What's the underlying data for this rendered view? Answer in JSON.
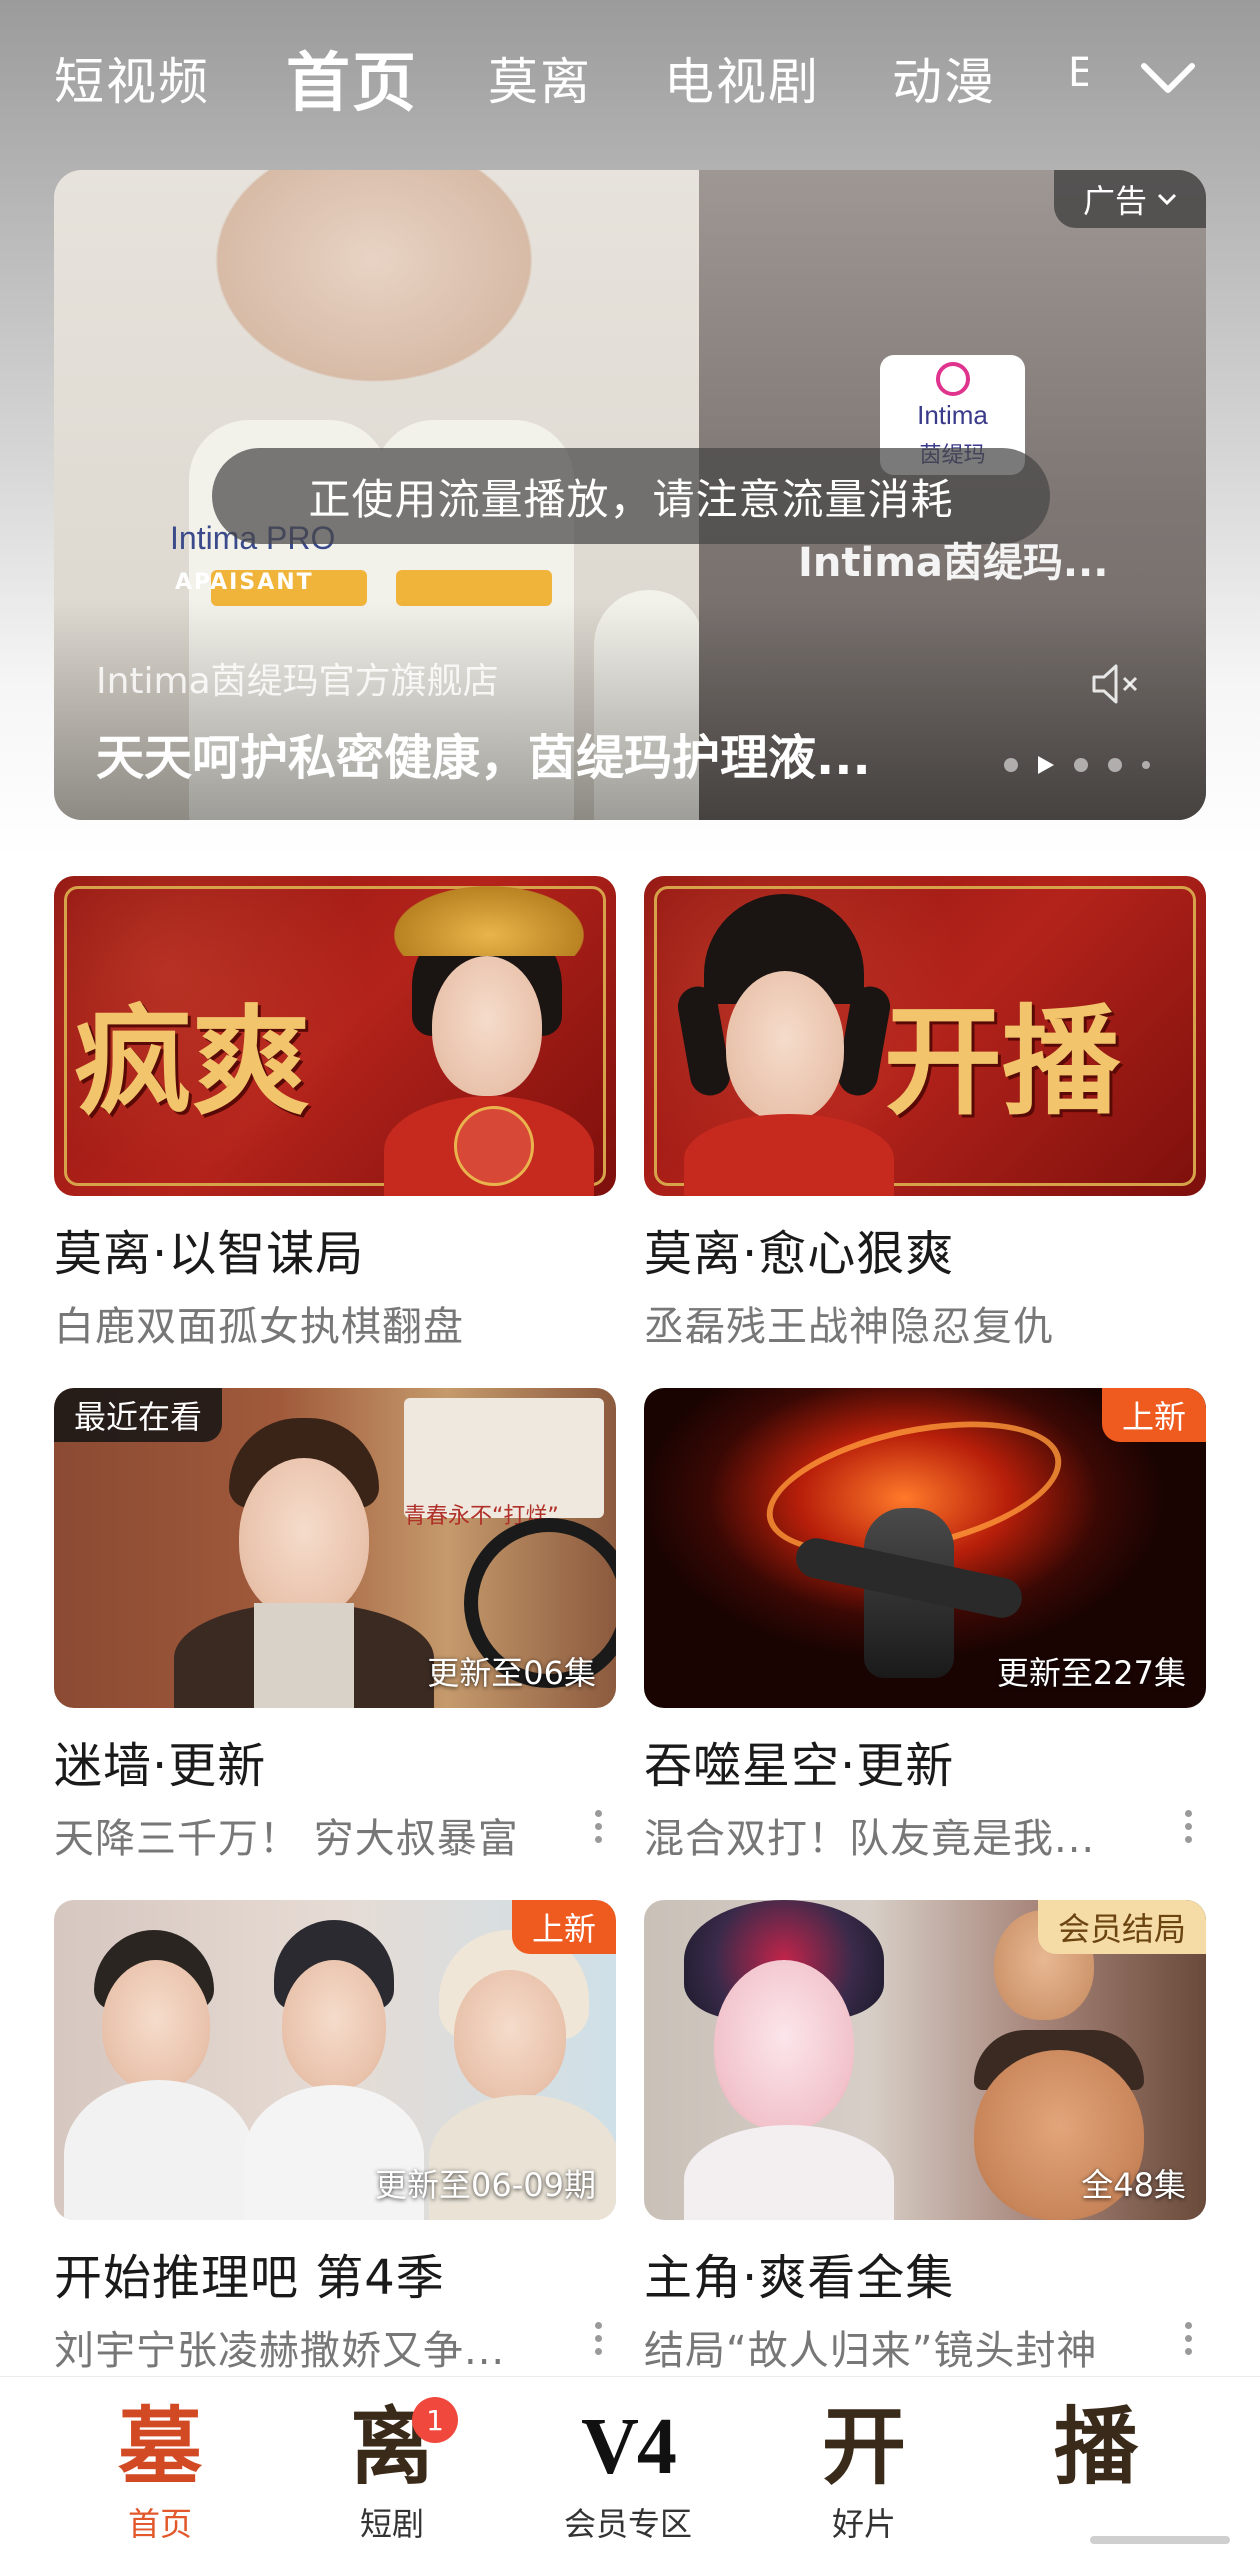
{
  "tabs": {
    "items": [
      "短视频",
      "首页",
      "莫离",
      "电视剧",
      "动漫"
    ],
    "overflow_text": "E",
    "active": "首页"
  },
  "ad": {
    "badge": "广告",
    "toast": "正使用流量播放，请注意流量消耗",
    "brand_overlay": "Intima茵缇玛...",
    "brand_card_en": "Intima",
    "brand_card_cn": "茵缇玛",
    "store": "Intima茵缇玛官方旗舰店",
    "title": "天天呵护私密健康，茵缇玛护理液...",
    "product_text": "Intima PRO",
    "product_label": "APAISANT"
  },
  "cards": [
    {
      "title": "莫离·以智谋局",
      "subtitle": "白鹿双面孤女执棋翻盘",
      "calligraphy": "疯爽"
    },
    {
      "title": "莫离·愈心狠爽",
      "subtitle": "丞磊残王战神隐忍复仇",
      "calligraphy": "开播"
    },
    {
      "title": "迷墙·更新",
      "subtitle": "天降三千万！ 穷大叔暴富",
      "badge_left": "最近在看",
      "episodes": "更新至06集",
      "sign_text": "青春永不“打烊”"
    },
    {
      "title": "吞噬星空·更新",
      "subtitle": "混合双打！队友竟是我...",
      "badge_right": "上新",
      "episodes": "更新至227集"
    },
    {
      "title": "开始推理吧 第4季",
      "subtitle": "刘宇宁张凌赫撒娇又争...",
      "badge_right": "上新",
      "episodes": "更新至06-09期"
    },
    {
      "title": "主角·爽看全集",
      "subtitle": "结局“故人归来”镜头封神",
      "badge_right": "会员结局",
      "episodes": "全48集"
    }
  ],
  "bottom_nav": {
    "items": [
      {
        "glyph": "墓",
        "label": "首页"
      },
      {
        "glyph": "离",
        "label": "短剧",
        "badge": "1"
      },
      {
        "glyph": "V4",
        "label": "会员专区"
      },
      {
        "glyph": "开",
        "label": "好片"
      },
      {
        "glyph": "播",
        "label": ""
      }
    ]
  },
  "colors": {
    "accent": "#e2582a",
    "badge_new": "#ef5a1f",
    "badge_vip_bg": "#f5dca6",
    "notification": "#f0483c"
  }
}
